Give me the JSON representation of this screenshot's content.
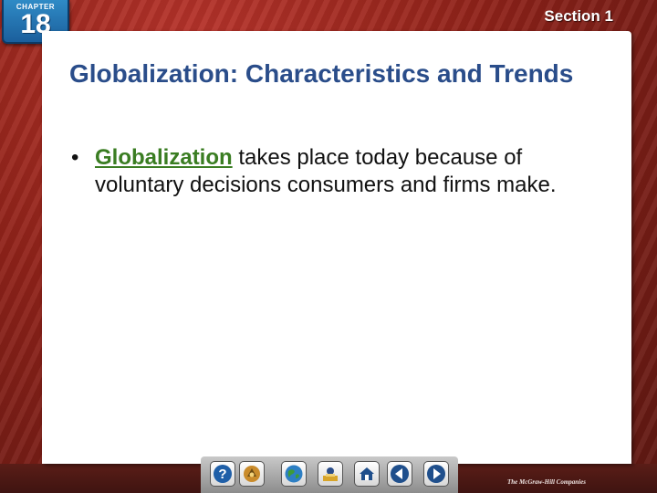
{
  "header": {
    "chapter_word": "CHAPTER",
    "chapter_number": "18",
    "section": "Section 1"
  },
  "slide": {
    "title": "Globalization: Characteristics and Trends",
    "bullets": [
      {
        "term": "Globalization",
        "text": " takes place today because of voluntary decisions consumers and firms make."
      }
    ]
  },
  "nav": {
    "buttons": [
      {
        "name": "help-button",
        "icon": "question-icon"
      },
      {
        "name": "resources-button",
        "icon": "resource-icon"
      },
      {
        "name": "globe-button",
        "icon": "globe-icon"
      },
      {
        "name": "reference-button",
        "icon": "reference-icon"
      },
      {
        "name": "home-button",
        "icon": "home-icon"
      },
      {
        "name": "previous-button",
        "icon": "arrow-left-icon"
      },
      {
        "name": "next-button",
        "icon": "arrow-right-icon"
      }
    ]
  },
  "footer": {
    "publisher": "The McGraw-Hill Companies"
  },
  "colors": {
    "title": "#2a4d8a",
    "term_link": "#3a7d22",
    "frame": "#8f2219",
    "chapter_badge": "#2f8bc6"
  }
}
